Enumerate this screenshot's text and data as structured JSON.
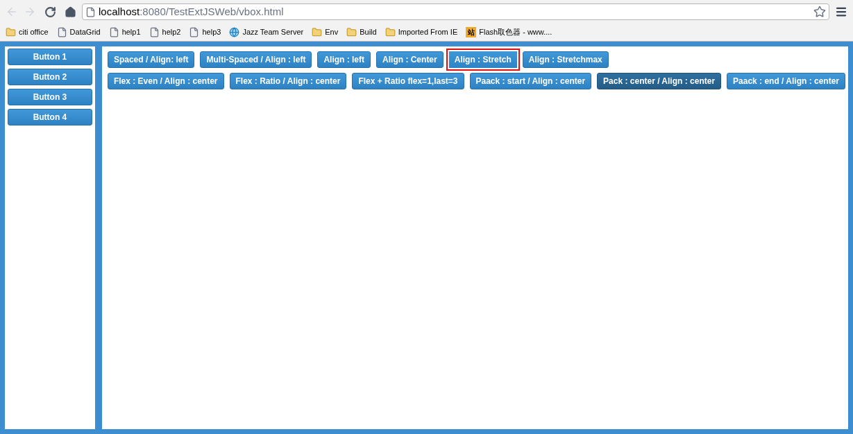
{
  "browser": {
    "url_host": "localhost",
    "url_rest": ":8080/TestExtJSWeb/vbox.html",
    "bookmarks": [
      {
        "label": "citi office",
        "kind": "folder"
      },
      {
        "label": "DataGrid",
        "kind": "page"
      },
      {
        "label": "help1",
        "kind": "page"
      },
      {
        "label": "help2",
        "kind": "page"
      },
      {
        "label": "help3",
        "kind": "page"
      },
      {
        "label": "Jazz Team Server",
        "kind": "globe"
      },
      {
        "label": "Env",
        "kind": "folder"
      },
      {
        "label": "Build",
        "kind": "folder"
      },
      {
        "label": "Imported From IE",
        "kind": "folder"
      },
      {
        "label": "Flash取色器  - www....",
        "kind": "app",
        "glyph": "站"
      }
    ]
  },
  "sidebar": {
    "buttons": [
      "Button 1",
      "Button 2",
      "Button 3",
      "Button 4"
    ]
  },
  "toolbar_rows": [
    [
      {
        "label": "Spaced / Align: left",
        "focused": false,
        "pressed": false
      },
      {
        "label": "Multi-Spaced / Align : left",
        "focused": false,
        "pressed": false
      },
      {
        "label": "Align : left",
        "focused": false,
        "pressed": false
      },
      {
        "label": "Align : Center",
        "focused": false,
        "pressed": false
      },
      {
        "label": "Align : Stretch",
        "focused": true,
        "pressed": false
      },
      {
        "label": "Align : Stretchmax",
        "focused": false,
        "pressed": false
      }
    ],
    [
      {
        "label": "Flex : Even / Align : center",
        "focused": false,
        "pressed": false
      },
      {
        "label": "Flex : Ratio / Align : center",
        "focused": false,
        "pressed": false
      },
      {
        "label": "Flex + Ratio flex=1,last=3",
        "focused": false,
        "pressed": false
      },
      {
        "label": "Paack : start / Align : center",
        "focused": false,
        "pressed": false
      },
      {
        "label": "Pack : center / Align : center",
        "focused": false,
        "pressed": true
      },
      {
        "label": "Paack : end / Align : center",
        "focused": false,
        "pressed": false
      }
    ]
  ]
}
